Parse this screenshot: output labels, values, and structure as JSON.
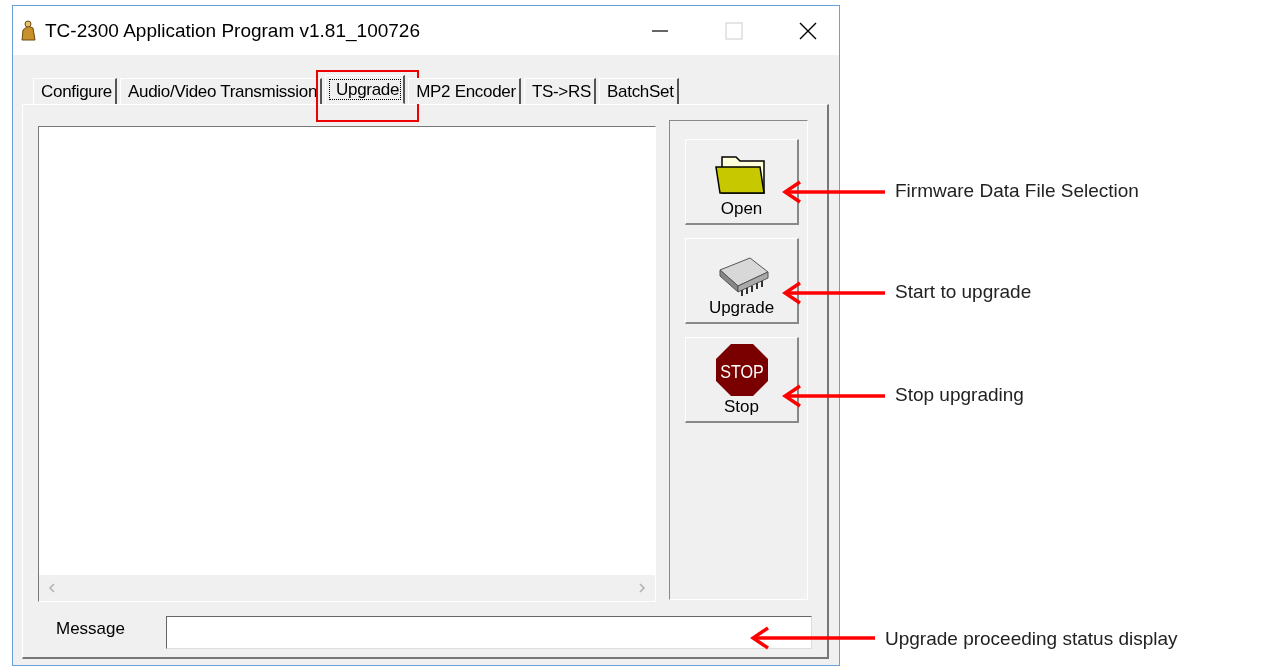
{
  "window": {
    "title": "TC-2300 Application Program v1.81_100726"
  },
  "tabs": [
    {
      "label": "Configure",
      "selected": false,
      "highlighted": false
    },
    {
      "label": "Audio/Video Transmission",
      "selected": false,
      "highlighted": false
    },
    {
      "label": "Upgrade",
      "selected": true,
      "highlighted": true
    },
    {
      "label": "MP2 Encoder",
      "selected": false,
      "highlighted": false
    },
    {
      "label": "TS->RS",
      "selected": false,
      "highlighted": false
    },
    {
      "label": "BatchSet",
      "selected": false,
      "highlighted": false
    }
  ],
  "buttons": [
    {
      "kind": "open",
      "label": "Open"
    },
    {
      "kind": "upgrade",
      "label": "Upgrade"
    },
    {
      "kind": "stop",
      "label": "Stop",
      "icon_text": "STOP"
    }
  ],
  "message": {
    "label": "Message"
  },
  "annotations": [
    {
      "text": "Firmware Data File Selection"
    },
    {
      "text": "Start to upgrade"
    },
    {
      "text": "Stop upgrading"
    },
    {
      "text": "Upgrade proceeding status display"
    }
  ]
}
